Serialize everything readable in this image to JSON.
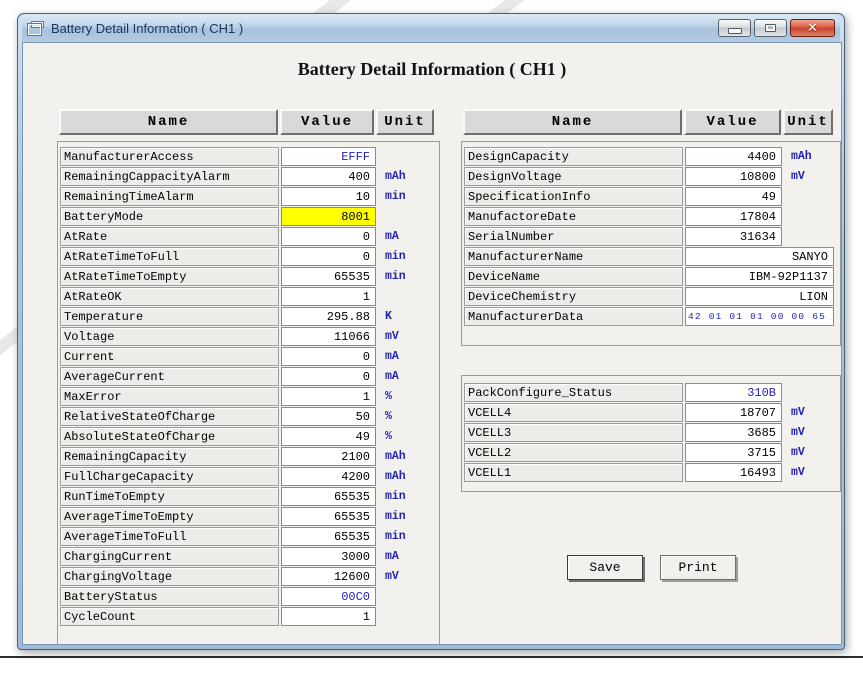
{
  "window": {
    "title": "Battery Detail Information ( CH1 )",
    "icons": {
      "close_glyph": "✕"
    }
  },
  "heading": "Battery Detail Information ( CH1 )",
  "headers": {
    "name": "Name",
    "value": "Value",
    "unit": "Unit"
  },
  "buttons": {
    "save": "Save",
    "print": "Print"
  },
  "colors": {
    "value_blue": "#2323b4",
    "highlight_yellow": "#ffff00",
    "titlebar_blue": "#b4cbe2",
    "close_red": "#c6402b"
  },
  "tables": {
    "left": {
      "rows": [
        {
          "name": "ManufacturerAccess",
          "value": "EFFF",
          "unit": "",
          "blue": true
        },
        {
          "name": "RemainingCappacityAlarm",
          "value": "400",
          "unit": "mAh"
        },
        {
          "name": "RemainingTimeAlarm",
          "value": "10",
          "unit": "min"
        },
        {
          "name": "BatteryMode",
          "value": "8001",
          "unit": "",
          "highlight": true
        },
        {
          "name": "AtRate",
          "value": "0",
          "unit": "mA"
        },
        {
          "name": "AtRateTimeToFull",
          "value": "0",
          "unit": "min"
        },
        {
          "name": "AtRateTimeToEmpty",
          "value": "65535",
          "unit": "min"
        },
        {
          "name": "AtRateOK",
          "value": "1",
          "unit": ""
        },
        {
          "name": "Temperature",
          "value": "295.88",
          "unit": "K"
        },
        {
          "name": "Voltage",
          "value": "11066",
          "unit": "mV"
        },
        {
          "name": "Current",
          "value": "0",
          "unit": "mA"
        },
        {
          "name": "AverageCurrent",
          "value": "0",
          "unit": "mA"
        },
        {
          "name": "MaxError",
          "value": "1",
          "unit": "%"
        },
        {
          "name": "RelativeStateOfCharge",
          "value": "50",
          "unit": "%"
        },
        {
          "name": "AbsoluteStateOfCharge",
          "value": "49",
          "unit": "%"
        },
        {
          "name": "RemainingCapacity",
          "value": "2100",
          "unit": "mAh"
        },
        {
          "name": "FullChargeCapacity",
          "value": "4200",
          "unit": "mAh"
        },
        {
          "name": "RunTimeToEmpty",
          "value": "65535",
          "unit": "min"
        },
        {
          "name": "AverageTimeToEmpty",
          "value": "65535",
          "unit": "min"
        },
        {
          "name": "AverageTimeToFull",
          "value": "65535",
          "unit": "min"
        },
        {
          "name": "ChargingCurrent",
          "value": "3000",
          "unit": "mA"
        },
        {
          "name": "ChargingVoltage",
          "value": "12600",
          "unit": "mV"
        },
        {
          "name": "BatteryStatus",
          "value": "00C0",
          "unit": "",
          "blue": true
        },
        {
          "name": "CycleCount",
          "value": "1",
          "unit": ""
        }
      ]
    },
    "right_top": {
      "rows": [
        {
          "name": "DesignCapacity",
          "value": "4400",
          "unit": "mAh"
        },
        {
          "name": "DesignVoltage",
          "value": "10800",
          "unit": "mV"
        },
        {
          "name": "SpecificationInfo",
          "value": "49",
          "unit": ""
        },
        {
          "name": "ManufactoreDate",
          "value": "17804",
          "unit": ""
        },
        {
          "name": "SerialNumber",
          "value": "31634",
          "unit": ""
        },
        {
          "name": "ManufacturerName",
          "value": "SANYO",
          "unit": "",
          "wide": true
        },
        {
          "name": "DeviceName",
          "value": "IBM-92P1137",
          "unit": "",
          "wide": true
        },
        {
          "name": "DeviceChemistry",
          "value": "LION",
          "unit": "",
          "wide": true
        },
        {
          "name": "ManufacturerData",
          "value": "42 01 01 01 00 00 65",
          "unit": "",
          "wide": true,
          "blue": true,
          "small": true
        }
      ]
    },
    "right_bottom": {
      "rows": [
        {
          "name": "PackConfigure_Status",
          "value": "310B",
          "unit": "",
          "blue": true
        },
        {
          "name": "VCELL4",
          "value": "18707",
          "unit": "mV"
        },
        {
          "name": "VCELL3",
          "value": "3685",
          "unit": "mV"
        },
        {
          "name": "VCELL2",
          "value": "3715",
          "unit": "mV"
        },
        {
          "name": "VCELL1",
          "value": "16493",
          "unit": "mV"
        }
      ]
    }
  }
}
